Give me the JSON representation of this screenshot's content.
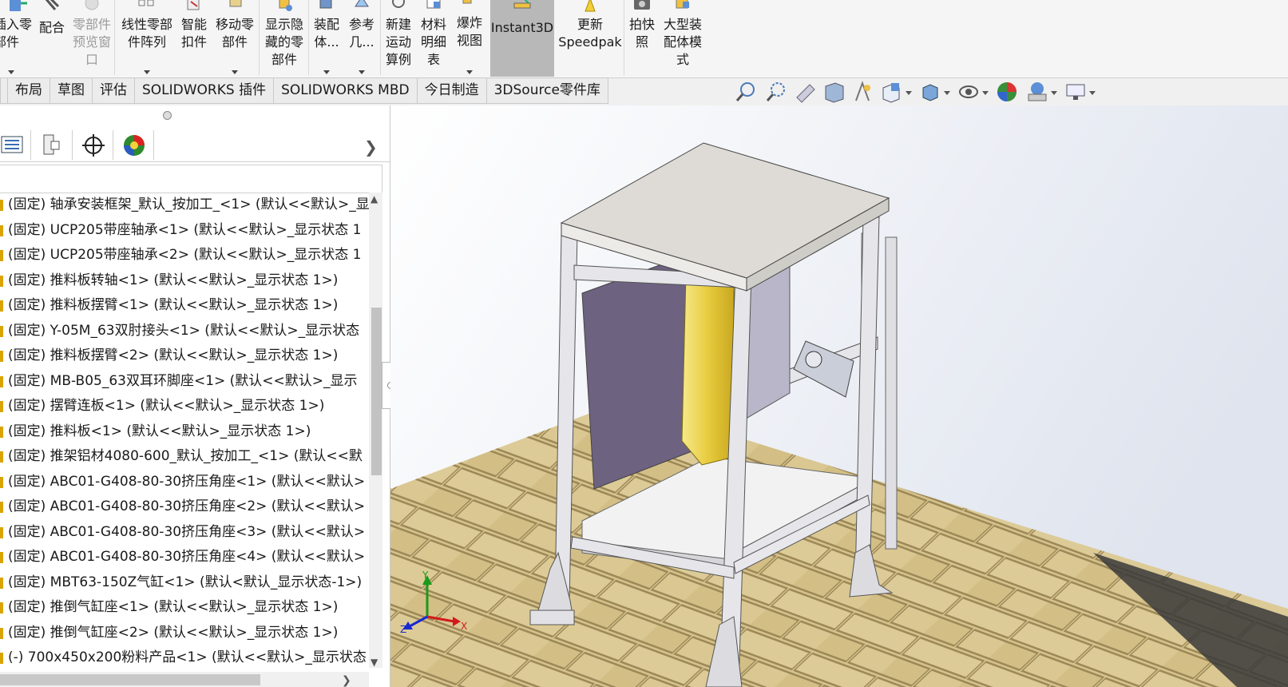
{
  "ribbon": {
    "insert_component": "插入零\n部件",
    "mate": "配合",
    "component_preview": "零部件\n预览窗\n口",
    "linear_pattern": "线性零部\n件阵列",
    "smart_fasteners": "智能\n扣件",
    "move_component": "移动零\n部件",
    "show_hidden": "显示隐\n藏的零\n部件",
    "assembly_features": "装配\n体...",
    "reference_geometry": "参考\n几...",
    "new_motion_study": "新建\n运动\n算例",
    "bill_of_materials": "材料\n明细\n表",
    "exploded_view": "爆炸\n视图",
    "instant3d": "Instant3D",
    "update_speedpak": "更新\nSpeedpak",
    "take_snapshot": "拍快\n照",
    "large_assembly_mode": "大型装\n配体模\n式"
  },
  "tabs": [
    "",
    "布局",
    "草图",
    "评估",
    "SOLIDWORKS 插件",
    "SOLIDWORKS MBD",
    "今日制造",
    "3DSource零件库"
  ],
  "view_toolbar": {
    "icons": [
      "zoom-to-fit-icon",
      "zoom-to-area-icon",
      "previous-view-icon",
      "section-view-icon",
      "dynamic-annotation-icon",
      "view-orientation-icon",
      "display-style-icon",
      "hide-show-items-icon",
      "edit-appearance-icon",
      "apply-scene-icon",
      "view-settings-icon"
    ]
  },
  "panel_tabs": [
    "feature-manager-icon",
    "property-manager-icon",
    "configuration-manager-icon",
    "display-manager-icon"
  ],
  "tree": {
    "items": [
      "(固定) 轴承安装框架_默认_按加工_<1> (默认<<默认>_显",
      "(固定) UCP205带座轴承<1> (默认<<默认>_显示状态 1",
      "(固定) UCP205带座轴承<2> (默认<<默认>_显示状态 1",
      "(固定) 推料板转轴<1> (默认<<默认>_显示状态 1>)",
      "(固定) 推料板摆臂<1> (默认<<默认>_显示状态 1>)",
      "(固定) Y-05M_63双肘接头<1> (默认<<默认>_显示状态",
      "(固定) 推料板摆臂<2> (默认<<默认>_显示状态 1>)",
      "(固定) MB-B05_63双耳环脚座<1> (默认<<默认>_显示",
      "(固定) 摆臂连板<1> (默认<<默认>_显示状态 1>)",
      "(固定) 推料板<1> (默认<<默认>_显示状态 1>)",
      "(固定) 推架铝材4080-600_默认_按加工_<1> (默认<<默",
      "(固定) ABC01-G408-80-30挤压角座<1> (默认<<默认>",
      "(固定) ABC01-G408-80-30挤压角座<2> (默认<<默认>",
      "(固定) ABC01-G408-80-30挤压角座<3> (默认<<默认>",
      "(固定) ABC01-G408-80-30挤压角座<4> (默认<<默认>",
      "(固定) MBT63-150Z气缸<1> (默认<默认_显示状态-1>)",
      "(固定) 推倒气缸座<1> (默认<<默认>_显示状态 1>)",
      "(固定) 推倒气缸座<2> (默认<<默认>_显示状态 1>)",
      "(-) 700x450x200粉料产品<1> (默认<<默认>_显示状态"
    ]
  },
  "triad": {
    "x": "X",
    "y": "Y",
    "z": "Z"
  },
  "colors": {
    "accent_active": "#b8b8b8",
    "tree_marker": "#d9a400",
    "floor_brick": "#d9c68f",
    "frame": "#e2e2e6"
  }
}
